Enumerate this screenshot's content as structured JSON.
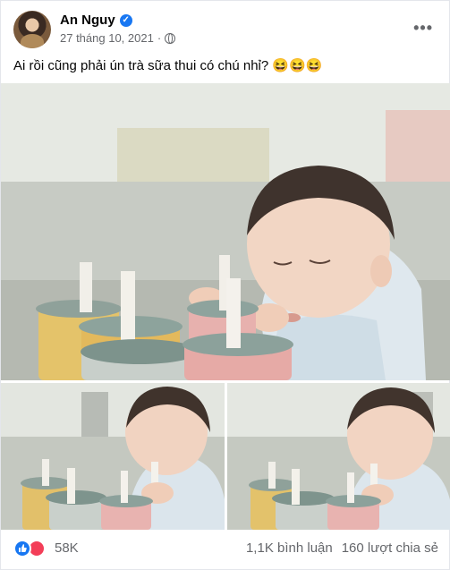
{
  "post": {
    "author": "An Nguy",
    "date": "27 tháng 10, 2021",
    "separator": "·",
    "caption": "Ai rồi cũng phải ún trà sữa thui có chú nhỉ? 😆😆😆",
    "more_label": "•••"
  },
  "reactions": {
    "count": "58K",
    "comments": "1,1K bình luận",
    "shares": "160 lượt chia sẻ"
  },
  "icons": {
    "verified": "verified-badge-icon",
    "privacy": "globe-icon",
    "like": "like-reaction-icon",
    "love": "love-reaction-icon"
  },
  "colors": {
    "brand": "#1877f2",
    "love": "#f33e58",
    "secondary_text": "#65676b"
  }
}
